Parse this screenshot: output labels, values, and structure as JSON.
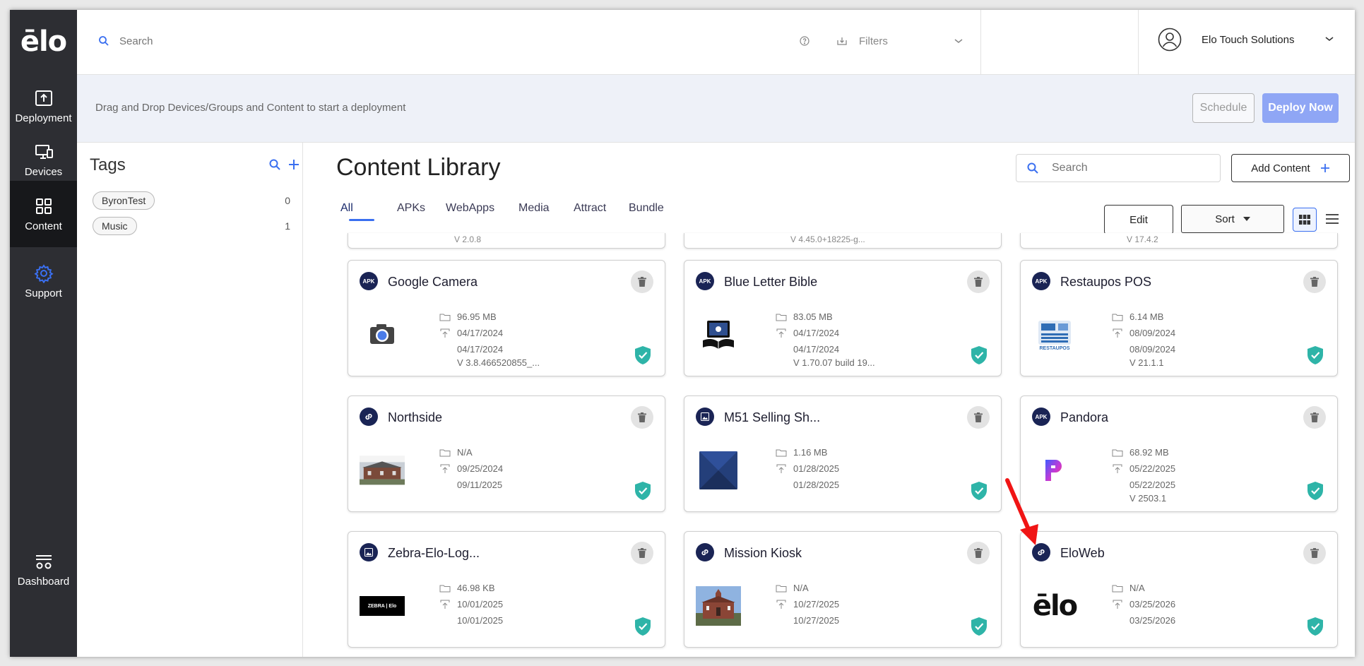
{
  "app": {
    "logo_text": "ēlo",
    "accent": "#3a6ff0"
  },
  "sidebar": {
    "items": [
      {
        "label": "Deployment",
        "icon": "upload-icon"
      },
      {
        "label": "Devices",
        "icon": "devices-icon"
      },
      {
        "label": "Content",
        "icon": "grid-icon"
      },
      {
        "label": "Support",
        "icon": "gear-icon"
      },
      {
        "label": "Dashboard",
        "icon": "dashboard-icon"
      }
    ]
  },
  "topbar": {
    "search_placeholder": "Search",
    "filters_label": "Filters",
    "account_name": "Elo Touch Solutions"
  },
  "banner": {
    "hint": "Drag and Drop Devices/Groups and Content to start a deployment",
    "schedule_label": "Schedule",
    "deploy_label": "Deploy Now"
  },
  "tags": {
    "title": "Tags",
    "items": [
      {
        "name": "ByronTest",
        "count": "0"
      },
      {
        "name": "Music",
        "count": "1"
      }
    ]
  },
  "library": {
    "title": "Content Library",
    "search_placeholder": "Search",
    "add_label": "Add Content",
    "edit_label": "Edit",
    "sort_label": "Sort",
    "tabs": [
      "All",
      "APKs",
      "WebApps",
      "Media",
      "Attract",
      "Bundle"
    ],
    "partial_rows": [
      "V 2.0.8",
      "V 4.45.0+18225-g...",
      "V 17.4.2"
    ],
    "cards": [
      {
        "type": "APK",
        "title": "Google Camera",
        "size": "96.95 MB",
        "date1": "04/17/2024",
        "date2": "04/17/2024",
        "version": "V 3.8.466520855_..."
      },
      {
        "type": "APK",
        "title": "Blue Letter Bible",
        "size": "83.05 MB",
        "date1": "04/17/2024",
        "date2": "04/17/2024",
        "version": "V 1.70.07 build 19..."
      },
      {
        "type": "APK",
        "title": "Restaupos POS",
        "size": "6.14 MB",
        "date1": "08/09/2024",
        "date2": "08/09/2024",
        "version": "V 21.1.1"
      },
      {
        "type": "link",
        "title": "Northside",
        "size": "N/A",
        "date1": "09/25/2024",
        "date2": "09/11/2025",
        "version": ""
      },
      {
        "type": "image",
        "title": "M51 Selling Sh...",
        "size": "1.16 MB",
        "date1": "01/28/2025",
        "date2": "01/28/2025",
        "version": ""
      },
      {
        "type": "APK",
        "title": "Pandora",
        "size": "68.92 MB",
        "date1": "05/22/2025",
        "date2": "05/22/2025",
        "version": "V 2503.1"
      },
      {
        "type": "image",
        "title": "Zebra-Elo-Log...",
        "size": "46.98 KB",
        "date1": "10/01/2025",
        "date2": "10/01/2025",
        "version": ""
      },
      {
        "type": "link",
        "title": "Mission Kiosk",
        "size": "N/A",
        "date1": "10/27/2025",
        "date2": "10/27/2025",
        "version": ""
      },
      {
        "type": "link",
        "title": "EloWeb",
        "size": "N/A",
        "date1": "03/25/2026",
        "date2": "03/25/2026",
        "version": ""
      }
    ],
    "thumb_labels": {
      "restaupos": "RESTAUPOS",
      "zebra": "ZEBRA | Elo",
      "elo": "ēlo"
    }
  },
  "annotation": {
    "arrow_color": "#f01515"
  }
}
